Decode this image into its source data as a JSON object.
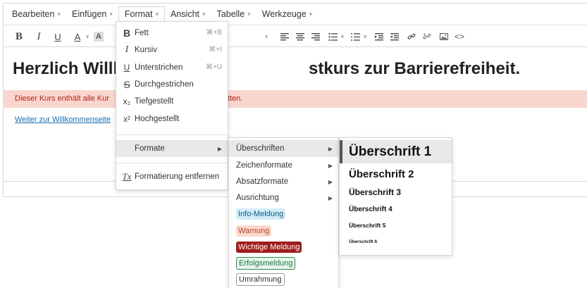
{
  "menubar": {
    "items": [
      {
        "label": "Bearbeiten"
      },
      {
        "label": "Einfügen"
      },
      {
        "label": "Format"
      },
      {
        "label": "Ansicht"
      },
      {
        "label": "Tabelle"
      },
      {
        "label": "Werkzeuge"
      }
    ]
  },
  "toolbar": {
    "bold": "B",
    "italic": "I",
    "underline": "U",
    "text_color": "A",
    "bg_color": "A"
  },
  "content": {
    "heading_part1": "Herzlich Willk",
    "heading_part2": "stkurs zur Barrierefreiheit.",
    "notice_part1": "Dieser Kurs enthält alle Kur",
    "notice_part2": "tten.",
    "link": "Weiter zur Willkommenseite"
  },
  "format_menu": {
    "items": [
      {
        "icon": "B",
        "label": "Fett",
        "shortcut": "⌘+B"
      },
      {
        "icon": "I",
        "label": "Kursiv",
        "shortcut": "⌘+I"
      },
      {
        "icon": "U",
        "label": "Unterstrichen",
        "shortcut": "⌘+U"
      },
      {
        "icon": "S",
        "label": "Durchgestrichen",
        "shortcut": ""
      },
      {
        "icon": "x₂",
        "label": "Tiefgestellt",
        "shortcut": ""
      },
      {
        "icon": "x²",
        "label": "Hochgestellt",
        "shortcut": ""
      }
    ],
    "formate": "Formate",
    "clear": "Formatierung entfernen",
    "clear_icon": "Tx"
  },
  "formate_menu": {
    "items": [
      {
        "label": "Überschriften"
      },
      {
        "label": "Zeichenformate"
      },
      {
        "label": "Absatzformate"
      },
      {
        "label": "Ausrichtung"
      }
    ],
    "tags": [
      {
        "label": "Info-Meldung",
        "bg": "#d3ecf8",
        "color": "#0c5a80",
        "border": "#d3ecf8"
      },
      {
        "label": "Warnung",
        "bg": "#fbd9cc",
        "color": "#b7402a",
        "border": "#fbd9cc"
      },
      {
        "label": "Wichtige Meldung",
        "bg": "#a01d1d",
        "color": "#ffffff",
        "border": "#a01d1d"
      },
      {
        "label": "Erfolgsmeldung",
        "bg": "#e6f5ec",
        "color": "#1d7a3f",
        "border": "#2e8b50"
      },
      {
        "label": "Umrahmung",
        "bg": "#ffffff",
        "color": "#333333",
        "border": "#999999"
      }
    ]
  },
  "headings_menu": {
    "items": [
      {
        "label": "Überschrift 1"
      },
      {
        "label": "Überschrift 2"
      },
      {
        "label": "Überschrift 3"
      },
      {
        "label": "Überschrift 4"
      },
      {
        "label": "Überschrift 5"
      },
      {
        "label": "Überschrift 6"
      }
    ]
  }
}
